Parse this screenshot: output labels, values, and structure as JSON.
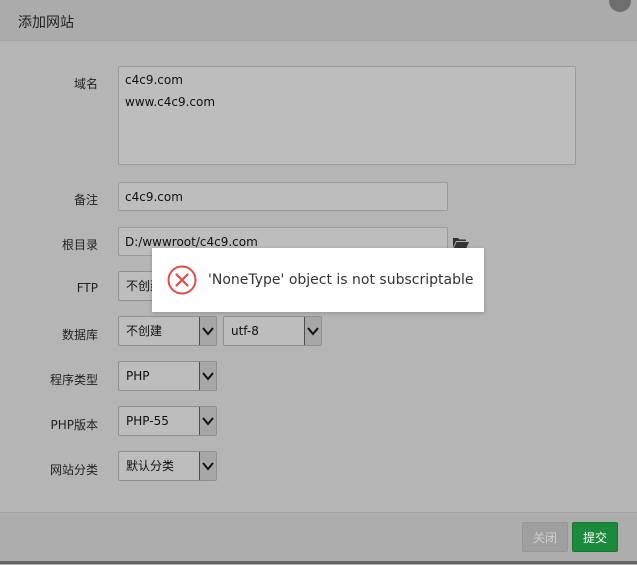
{
  "dialog": {
    "title": "添加网站"
  },
  "form": {
    "domain": {
      "label": "域名",
      "lines": [
        "c4c9.com",
        "www.c4c9.com"
      ]
    },
    "remark": {
      "label": "备注",
      "value": "c4c9.com"
    },
    "root_dir": {
      "label": "根目录",
      "value": "D:/wwwroot/c4c9.com"
    },
    "ftp": {
      "label": "FTP",
      "value": "不创建"
    },
    "database": {
      "label": "数据库",
      "value": "不创建",
      "charset": "utf-8"
    },
    "program_type": {
      "label": "程序类型",
      "value": "PHP"
    },
    "php_version": {
      "label": "PHP版本",
      "value": "PHP-55"
    },
    "site_category": {
      "label": "网站分类",
      "value": "默认分类"
    }
  },
  "footer": {
    "close_label": "关闭",
    "submit_label": "提交"
  },
  "toast": {
    "message": "'NoneType' object is not subscriptable",
    "icon": "error-circle-x-icon"
  },
  "colors": {
    "submit": "#1b8a3c",
    "error": "#e14b4b"
  }
}
